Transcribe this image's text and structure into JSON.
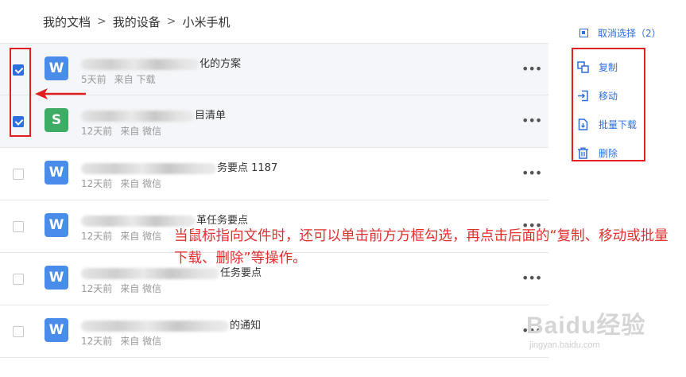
{
  "breadcrumb": [
    "我的文档",
    "我的设备",
    "小米手机"
  ],
  "files": [
    {
      "icon": "W",
      "type": "word",
      "name_suffix": "化的方案",
      "time": "5天前",
      "source": "来自 下载",
      "checked": true
    },
    {
      "icon": "S",
      "type": "sheet",
      "name_suffix": "目清单",
      "time": "12天前",
      "source": "来自 微信",
      "checked": true
    },
    {
      "icon": "W",
      "type": "word",
      "name_suffix": "务要点 1187",
      "time": "12天前",
      "source": "来自 微信",
      "checked": false
    },
    {
      "icon": "W",
      "type": "word",
      "name_suffix": "革任务要点",
      "time": "12天前",
      "source": "来自 微信",
      "checked": false
    },
    {
      "icon": "W",
      "type": "word",
      "name_suffix": "任务要点",
      "time": "12天前",
      "source": "来自 微信",
      "checked": false
    },
    {
      "icon": "W",
      "type": "word",
      "name_suffix": "的通知",
      "time": "12天前",
      "source": "来自 微信",
      "checked": false
    }
  ],
  "more_label": "•••",
  "cancel_label": "取消选择（2）",
  "ops": {
    "copy": "复制",
    "move": "移动",
    "batch_download": "批量下载",
    "delete": "删除"
  },
  "annotation": "当鼠标指向文件时，还可以单击前方方框勾选，再点击后面的“复制、移动或批量下载、删除”等操作。",
  "watermark": {
    "brand": "Baidu经验",
    "url": "jingyan.baidu.com"
  },
  "colors": {
    "accent": "#2f6fdc",
    "annotation_red": "#e02020"
  }
}
